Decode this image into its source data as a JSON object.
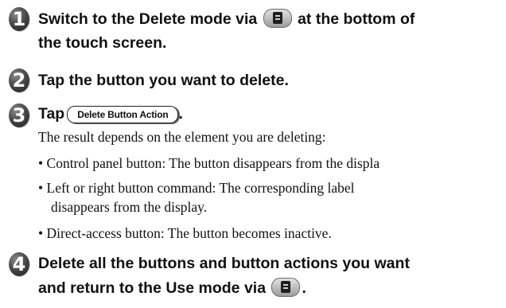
{
  "steps": [
    {
      "number": "1",
      "line1_before_icon": "Switch to the Delete mode via",
      "icon": "delete-mode-icon",
      "line1_after_icon": "at the bottom of",
      "line2": "the touch screen."
    },
    {
      "number": "2",
      "line1": "Tap the button you want to delete."
    },
    {
      "number": "3",
      "prefix": "Tap",
      "button_label": "Delete Button Action",
      "suffix": ".",
      "intro": "The result depends on the element you are deleting:",
      "bullets": [
        {
          "mark": "•",
          "line1": "Control panel button: The button disappears from the displa"
        },
        {
          "mark": "•",
          "line1": "Left or right button command: The corresponding label",
          "line2": "disappears from the display."
        },
        {
          "mark": "•",
          "line1": "Direct-access button: The button becomes inactive."
        }
      ]
    },
    {
      "number": "4",
      "line1": "Delete all the buttons and button actions you want",
      "line2_before_icon": "and return to the Use mode via",
      "icon": "use-mode-icon",
      "line2_after_icon": "."
    }
  ]
}
